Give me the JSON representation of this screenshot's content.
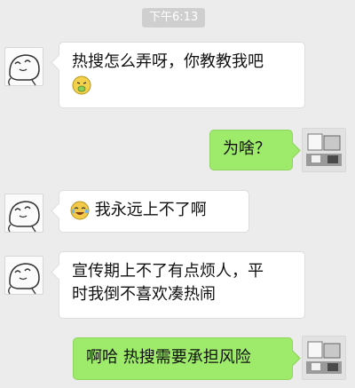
{
  "status": {
    "time": "下午6:13"
  },
  "messages": [
    {
      "side": "left",
      "emoji_icon": "sick-face-emoji",
      "text": "热搜怎么弄呀，你教教我吧"
    },
    {
      "side": "right",
      "text": "为啥？"
    },
    {
      "side": "left",
      "emoji_icon": "crying-laughing-emoji",
      "text": "我永远上不了啊"
    },
    {
      "side": "left",
      "text_line1": "宣传期上不了有点烦人，平",
      "text_line2": "时我倒不喜欢凑热闹"
    },
    {
      "side": "right",
      "text": "啊哈 热搜需要承担风险"
    }
  ],
  "colors": {
    "background": "#ececec",
    "incoming_bubble": "#ffffff",
    "outgoing_bubble": "#9eea6a",
    "timestamp_bg": "#cfcfcf"
  }
}
